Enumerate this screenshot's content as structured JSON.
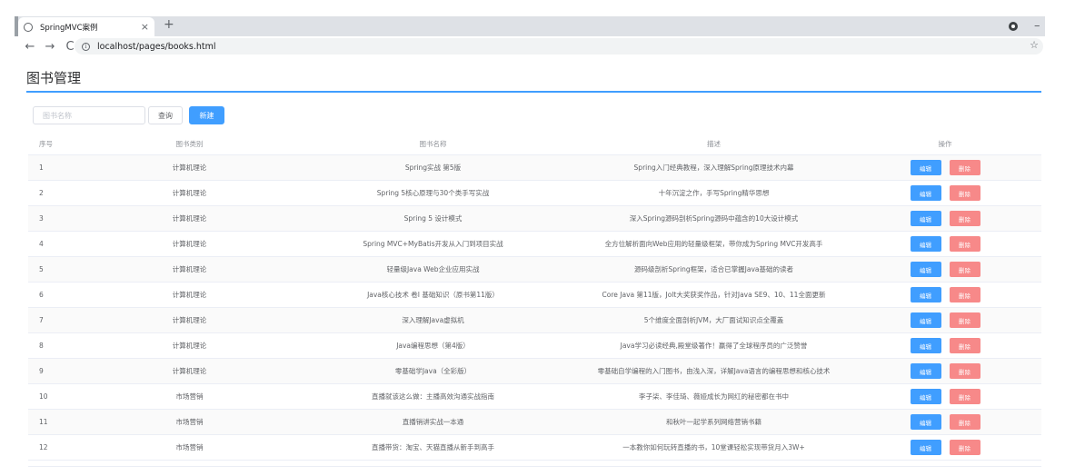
{
  "browser": {
    "tab_title": "SpringMVC案例",
    "tab_close": "×",
    "new_tab": "+",
    "back": "←",
    "forward": "→",
    "reload": "C",
    "info": "i",
    "url": "localhost/pages/books.html",
    "star": "☆",
    "minimize": "–"
  },
  "page": {
    "title": "图书管理"
  },
  "toolbar": {
    "search_placeholder": "图书名称",
    "query_label": "查询",
    "new_label": "新建"
  },
  "table": {
    "headers": {
      "index": "序号",
      "category": "图书类别",
      "name": "图书名称",
      "description": "描述",
      "operations": "操作"
    },
    "edit_label": "编辑",
    "delete_label": "删除",
    "rows": [
      {
        "index": "1",
        "category": "计算机理论",
        "name": "Spring实战 第5版",
        "description": "Spring入门经典教程，深入理解Spring原理技术内幕"
      },
      {
        "index": "2",
        "category": "计算机理论",
        "name": "Spring 5核心原理与30个类手写实战",
        "description": "十年沉淀之作，手写Spring精华思想"
      },
      {
        "index": "3",
        "category": "计算机理论",
        "name": "Spring 5 设计模式",
        "description": "深入Spring源码剖析Spring源码中蕴含的10大设计模式"
      },
      {
        "index": "4",
        "category": "计算机理论",
        "name": "Spring MVC+MyBatis开发从入门到项目实战",
        "description": "全方位解析面向Web应用的轻量级框架，带你成为Spring MVC开发高手"
      },
      {
        "index": "5",
        "category": "计算机理论",
        "name": "轻量级Java Web企业应用实战",
        "description": "源码级剖析Spring框架，适合已掌握Java基础的读者"
      },
      {
        "index": "6",
        "category": "计算机理论",
        "name": "Java核心技术 卷I 基础知识（原书第11版）",
        "description": "Core Java 第11版，Jolt大奖获奖作品，针对Java SE9、10、11全面更新"
      },
      {
        "index": "7",
        "category": "计算机理论",
        "name": "深入理解Java虚拟机",
        "description": "5个维度全面剖析JVM，大厂面试知识点全覆盖"
      },
      {
        "index": "8",
        "category": "计算机理论",
        "name": "Java编程思想（第4版）",
        "description": "Java学习必读经典,殿堂级著作！赢得了全球程序员的广泛赞誉"
      },
      {
        "index": "9",
        "category": "计算机理论",
        "name": "零基础学Java（全彩版）",
        "description": "零基础自学编程的入门图书，由浅入深，详解Java语言的编程思想和核心技术"
      },
      {
        "index": "10",
        "category": "市场营销",
        "name": "直播就该这么做：主播高效沟通实战指南",
        "description": "李子柒、李佳琦、薇娅成长为网红的秘密都在书中"
      },
      {
        "index": "11",
        "category": "市场营销",
        "name": "直播销讲实战一本通",
        "description": "和秋叶一起学系列网络营销书籍"
      },
      {
        "index": "12",
        "category": "市场营销",
        "name": "直播带货：淘宝、天猫直播从新手到高手",
        "description": "一本教你如何玩转直播的书，10堂课轻松实现带货月入3W+"
      }
    ]
  },
  "colors": {
    "primary": "#409eff",
    "danger": "#f78989",
    "stripe": "#fafafa"
  }
}
